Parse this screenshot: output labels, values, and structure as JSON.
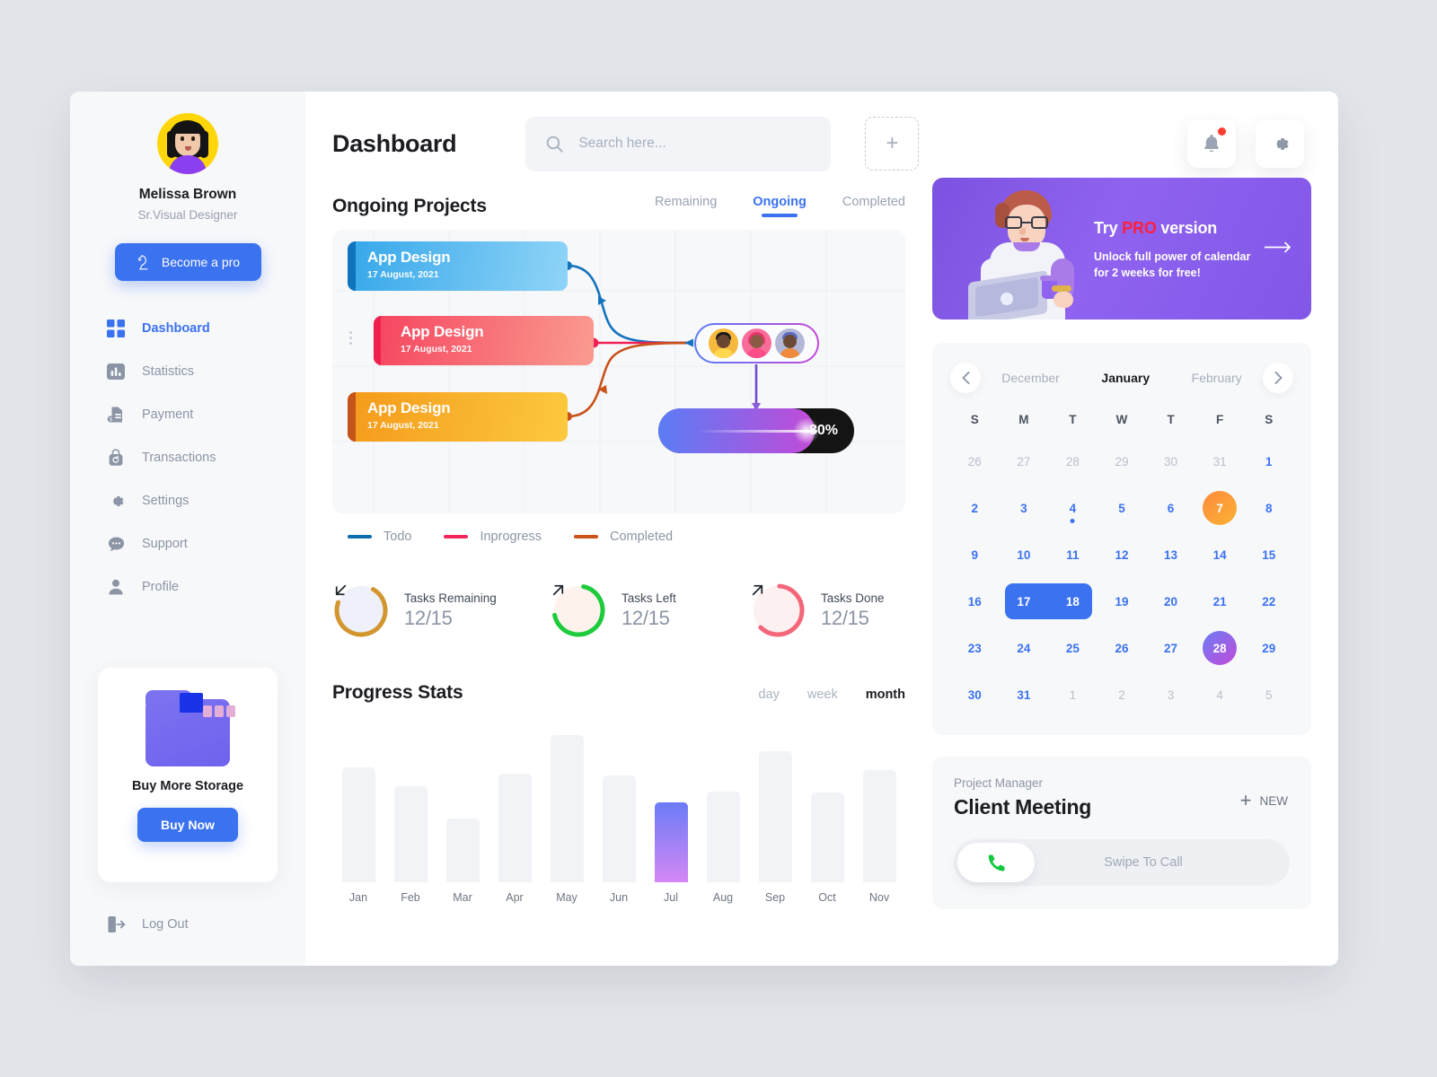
{
  "sidebar": {
    "user": {
      "name": "Melissa Brown",
      "role": "Sr.Visual Designer",
      "avatar_icon": "user-avatar"
    },
    "pro_button": {
      "label": "Become a pro",
      "icon": "chess-knight-icon"
    },
    "items": [
      {
        "label": "Dashboard",
        "icon": "grid-icon",
        "active": true
      },
      {
        "label": "Statistics",
        "icon": "bar-chart-icon",
        "active": false
      },
      {
        "label": "Payment",
        "icon": "payment-icon",
        "active": false
      },
      {
        "label": "Transactions",
        "icon": "transactions-icon",
        "active": false
      },
      {
        "label": "Settings",
        "icon": "gear-icon",
        "active": false
      },
      {
        "label": "Support",
        "icon": "chat-icon",
        "active": false
      },
      {
        "label": "Profile",
        "icon": "person-icon",
        "active": false
      }
    ],
    "storage": {
      "title": "Buy More Storage",
      "button": "Buy Now",
      "icon": "folder-icon"
    },
    "logout": {
      "label": "Log Out",
      "icon": "logout-icon"
    }
  },
  "header": {
    "title": "Dashboard",
    "search": {
      "placeholder": "Search here...",
      "value": "",
      "icon": "search-icon"
    },
    "add_button": "+",
    "notification_icon": "bell-icon",
    "settings_icon": "gear-icon",
    "has_notification": true
  },
  "projects": {
    "title": "Ongoing Projects",
    "tabs": [
      {
        "label": "Remaining",
        "active": false
      },
      {
        "label": "Ongoing",
        "active": true
      },
      {
        "label": "Completed",
        "active": false
      }
    ],
    "cards": [
      {
        "name": "App Design",
        "date": "17 August, 2021",
        "status": "todo"
      },
      {
        "name": "App Design",
        "date": "17 August, 2021",
        "status": "inprogress"
      },
      {
        "name": "App Design",
        "date": "17 August, 2021",
        "status": "completed"
      }
    ],
    "progress": {
      "percent": "80%",
      "value": 80
    },
    "assignees": [
      "member-1",
      "member-2",
      "member-3"
    ],
    "legend": [
      {
        "label": "Todo",
        "color": "#0b6cb0"
      },
      {
        "label": "Inprogress",
        "color": "#f4265c"
      },
      {
        "label": "Completed",
        "color": "#c8521a"
      }
    ]
  },
  "task_stats": [
    {
      "label": "Tasks Remaining",
      "value": "12/15",
      "color": "#d3962f",
      "icon": "arrow-down-left-icon",
      "pct": 72
    },
    {
      "label": "Tasks Left",
      "value": "12/15",
      "color": "#1ecb3c",
      "icon": "arrow-up-right-icon",
      "pct": 68
    },
    {
      "label": "Tasks Done",
      "value": "12/15",
      "color": "#f4667a",
      "icon": "arrow-up-right-icon",
      "pct": 60
    }
  ],
  "chart_data": {
    "type": "bar",
    "title": "Progress Stats",
    "categories": [
      "Jan",
      "Feb",
      "Mar",
      "Apr",
      "May",
      "Jun",
      "Jul",
      "Aug",
      "Sep",
      "Oct",
      "Nov"
    ],
    "values": [
      72,
      60,
      40,
      68,
      92,
      67,
      50,
      57,
      82,
      56,
      70
    ],
    "highlight_index": 6,
    "highlight_color": "#a97bf0",
    "bar_color": "#f1f3f7",
    "xlabel": "",
    "ylabel": "",
    "ylim": [
      0,
      100
    ],
    "grid": false,
    "range_options": [
      {
        "label": "day",
        "active": false
      },
      {
        "label": "week",
        "active": false
      },
      {
        "label": "month",
        "active": true
      }
    ]
  },
  "promo": {
    "heading_before": "Try ",
    "heading_highlight": "PRO",
    "heading_after": " version",
    "body": "Unlock full power of calendar\nfor 2 weeks for free!",
    "arrow_icon": "arrow-right-icon",
    "illustration": "person-with-laptop"
  },
  "calendar": {
    "prev_icon": "chevron-left-icon",
    "next_icon": "chevron-right-icon",
    "months": [
      {
        "label": "December",
        "current": false
      },
      {
        "label": "January",
        "current": true
      },
      {
        "label": "February",
        "current": false
      }
    ],
    "dow": [
      "S",
      "M",
      "T",
      "W",
      "T",
      "F",
      "S"
    ],
    "weeks": [
      [
        {
          "n": "26",
          "mute": true
        },
        {
          "n": "27",
          "mute": true
        },
        {
          "n": "28",
          "mute": true
        },
        {
          "n": "29",
          "mute": true
        },
        {
          "n": "30",
          "mute": true
        },
        {
          "n": "31",
          "mute": true
        },
        {
          "n": "1"
        }
      ],
      [
        {
          "n": "2"
        },
        {
          "n": "3"
        },
        {
          "n": "4",
          "dot": true
        },
        {
          "n": "5"
        },
        {
          "n": "6"
        },
        {
          "n": "7",
          "mark": "orange"
        },
        {
          "n": "8"
        }
      ],
      [
        {
          "n": "9"
        },
        {
          "n": "10"
        },
        {
          "n": "11"
        },
        {
          "n": "12"
        },
        {
          "n": "13"
        },
        {
          "n": "14"
        },
        {
          "n": "15"
        }
      ],
      [
        {
          "n": "16"
        },
        {
          "n": "17",
          "sel": true
        },
        {
          "n": "18",
          "sel": true
        },
        {
          "n": "19"
        },
        {
          "n": "20"
        },
        {
          "n": "21"
        },
        {
          "n": "22"
        }
      ],
      [
        {
          "n": "23"
        },
        {
          "n": "24"
        },
        {
          "n": "25"
        },
        {
          "n": "26"
        },
        {
          "n": "27"
        },
        {
          "n": "28",
          "mark": "purple"
        },
        {
          "n": "29"
        }
      ],
      [
        {
          "n": "30"
        },
        {
          "n": "31"
        },
        {
          "n": "1",
          "mute": true
        },
        {
          "n": "2",
          "mute": true
        },
        {
          "n": "3",
          "mute": true
        },
        {
          "n": "4",
          "mute": true
        },
        {
          "n": "5",
          "mute": true
        }
      ]
    ]
  },
  "project_manager": {
    "subtitle": "Project Manager",
    "title": "Client Meeting",
    "new_label": "NEW",
    "new_icon": "plus-icon",
    "swipe_label": "Swipe To Call",
    "phone_icon": "phone-icon"
  }
}
